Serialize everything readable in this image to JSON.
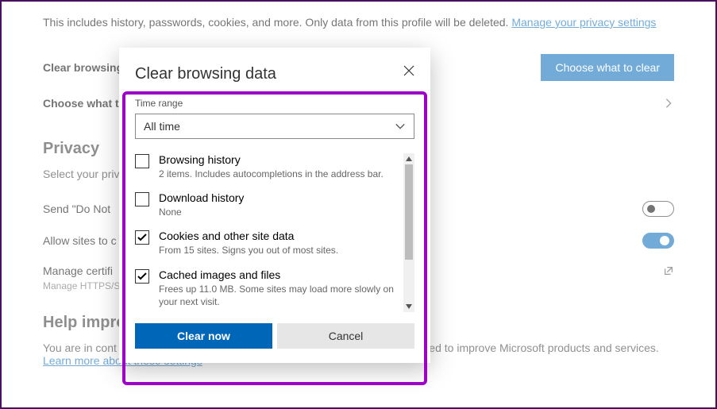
{
  "page": {
    "intro_prefix": "This includes history, passwords, cookies, and more. Only data from this profile will be deleted. ",
    "intro_link": "Manage your privacy settings",
    "row_clear_label": "Clear browsing",
    "choose_btn": "Choose what to clear",
    "row_choose_label": "Choose what t",
    "privacy_title": "Privacy",
    "privacy_desc": "Select your priv",
    "dnt_label": "Send \"Do Not",
    "allow_sites_label": "Allow sites to c",
    "manage_cert_label": "Manage certifi",
    "manage_cert_sub": "Manage HTTPS/S",
    "help_title": "Help impro",
    "help_body_prefix": "You are in cont",
    "help_body_suffix": "oft. This data is used to improve Microsoft products and services. ",
    "help_link": "Learn more about these settings"
  },
  "dialog": {
    "title": "Clear browsing data",
    "time_range_label": "Time range",
    "time_range_value": "All time",
    "options": [
      {
        "title": "Browsing history",
        "desc": "2 items. Includes autocompletions in the address bar.",
        "checked": false
      },
      {
        "title": "Download history",
        "desc": "None",
        "checked": false
      },
      {
        "title": "Cookies and other site data",
        "desc": "From 15 sites. Signs you out of most sites.",
        "checked": true
      },
      {
        "title": "Cached images and files",
        "desc": "Frees up 11.0 MB. Some sites may load more slowly on your next visit.",
        "checked": true
      }
    ],
    "clear_btn": "Clear now",
    "cancel_btn": "Cancel"
  }
}
